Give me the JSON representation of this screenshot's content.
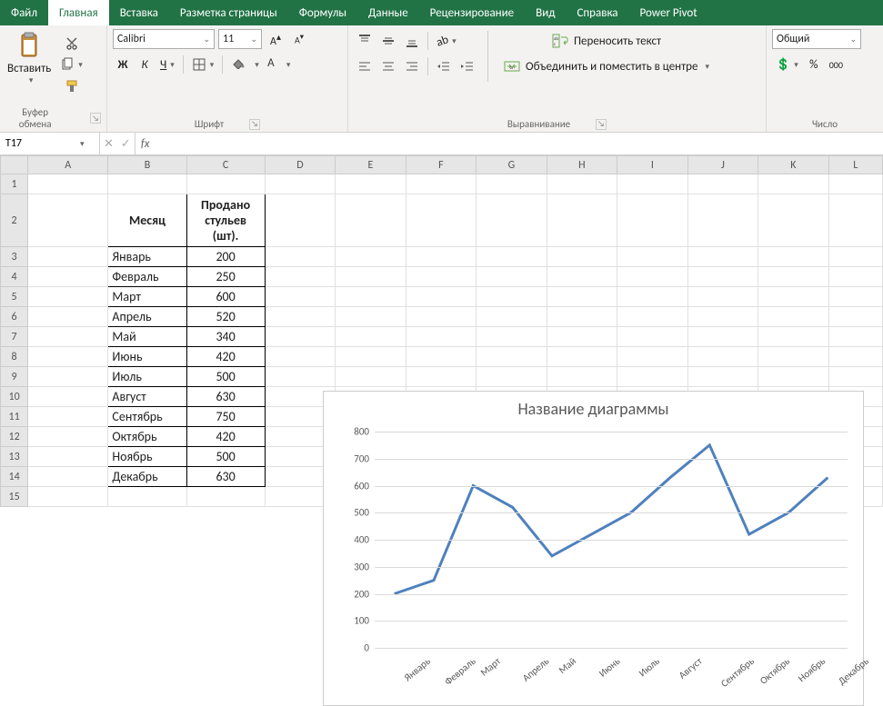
{
  "tabs": {
    "file": "Файл",
    "home": "Главная",
    "insert": "Вставка",
    "page_layout": "Разметка страницы",
    "formulas": "Формулы",
    "data": "Данные",
    "review": "Рецензирование",
    "view": "Вид",
    "help": "Справка",
    "power_pivot": "Power Pivot"
  },
  "ribbon": {
    "clipboard": {
      "paste": "Вставить",
      "group": "Буфер обмена"
    },
    "font": {
      "name": "Calibri",
      "size": "11",
      "bold": "Ж",
      "italic": "К",
      "underline": "Ч",
      "group": "Шрифт"
    },
    "alignment": {
      "wrap": "Переносить текст",
      "merge": "Объединить и поместить в центре",
      "group": "Выравнивание"
    },
    "number": {
      "format": "Общий",
      "group": "Число"
    }
  },
  "formula_bar": {
    "name_box": "T17",
    "fx": "fx",
    "value": ""
  },
  "columns": [
    "A",
    "B",
    "C",
    "D",
    "E",
    "F",
    "G",
    "H",
    "I",
    "J",
    "K",
    "L"
  ],
  "row_numbers": [
    "1",
    "2",
    "3",
    "4",
    "5",
    "6",
    "7",
    "8",
    "9",
    "10",
    "11",
    "12",
    "13",
    "14",
    "15"
  ],
  "table": {
    "h_month": "Месяц",
    "h_sold": "Продано стульев (шт).",
    "rows": [
      {
        "m": "Январь",
        "v": "200"
      },
      {
        "m": "Февраль",
        "v": "250"
      },
      {
        "m": "Март",
        "v": "600"
      },
      {
        "m": "Апрель",
        "v": "520"
      },
      {
        "m": "Май",
        "v": "340"
      },
      {
        "m": "Июнь",
        "v": "420"
      },
      {
        "m": "Июль",
        "v": "500"
      },
      {
        "m": "Август",
        "v": "630"
      },
      {
        "m": "Сентябрь",
        "v": "750"
      },
      {
        "m": "Октябрь",
        "v": "420"
      },
      {
        "m": "Ноябрь",
        "v": "500"
      },
      {
        "m": "Декабрь",
        "v": "630"
      }
    ]
  },
  "chart_data": {
    "type": "line",
    "title": "Название диаграммы",
    "categories": [
      "Январь",
      "Февраль",
      "Март",
      "Апрель",
      "Май",
      "Июнь",
      "Июль",
      "Август",
      "Сентябрь",
      "Октябрь",
      "Ноябрь",
      "Декабрь"
    ],
    "values": [
      200,
      250,
      600,
      520,
      340,
      420,
      500,
      630,
      750,
      420,
      500,
      630
    ],
    "ylim": [
      0,
      800
    ],
    "yticks": [
      0,
      100,
      200,
      300,
      400,
      500,
      600,
      700,
      800
    ],
    "xlabel": "",
    "ylabel": ""
  }
}
